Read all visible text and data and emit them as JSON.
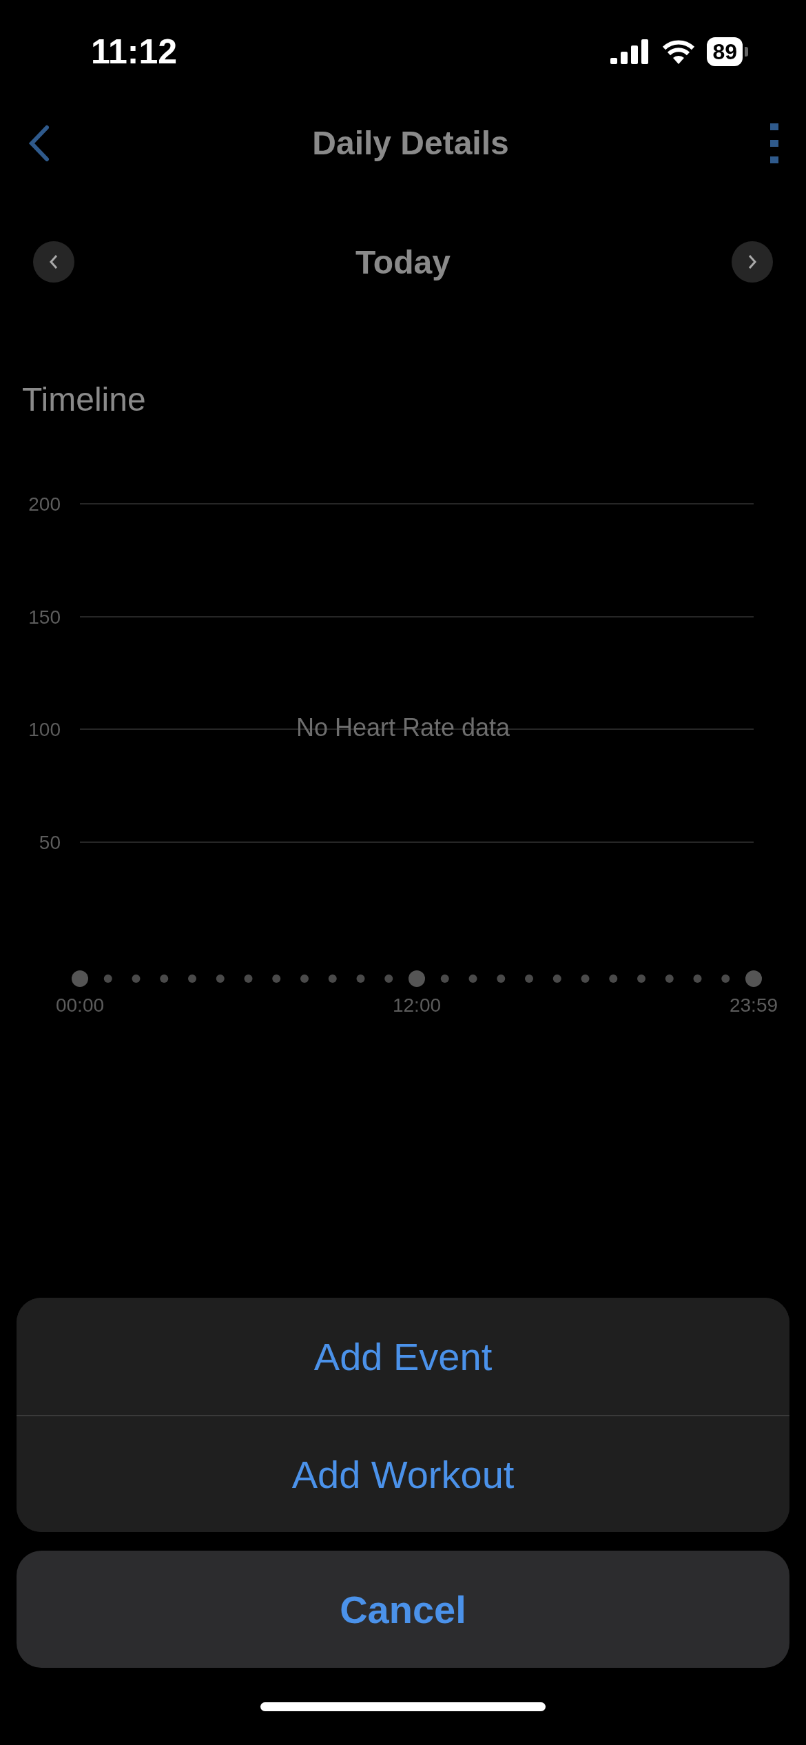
{
  "status_bar": {
    "time": "11:12",
    "battery": "89"
  },
  "nav": {
    "title": "Daily Details"
  },
  "date_nav": {
    "label": "Today"
  },
  "section_title": "Timeline",
  "chart": {
    "y_labels": [
      "200",
      "150",
      "100",
      "50"
    ],
    "x_labels": [
      "00:00",
      "12:00",
      "23:59"
    ],
    "empty_message": "No Heart Rate data"
  },
  "action_sheet": {
    "actions": [
      "Add Event",
      "Add Workout"
    ],
    "cancel": "Cancel"
  }
}
